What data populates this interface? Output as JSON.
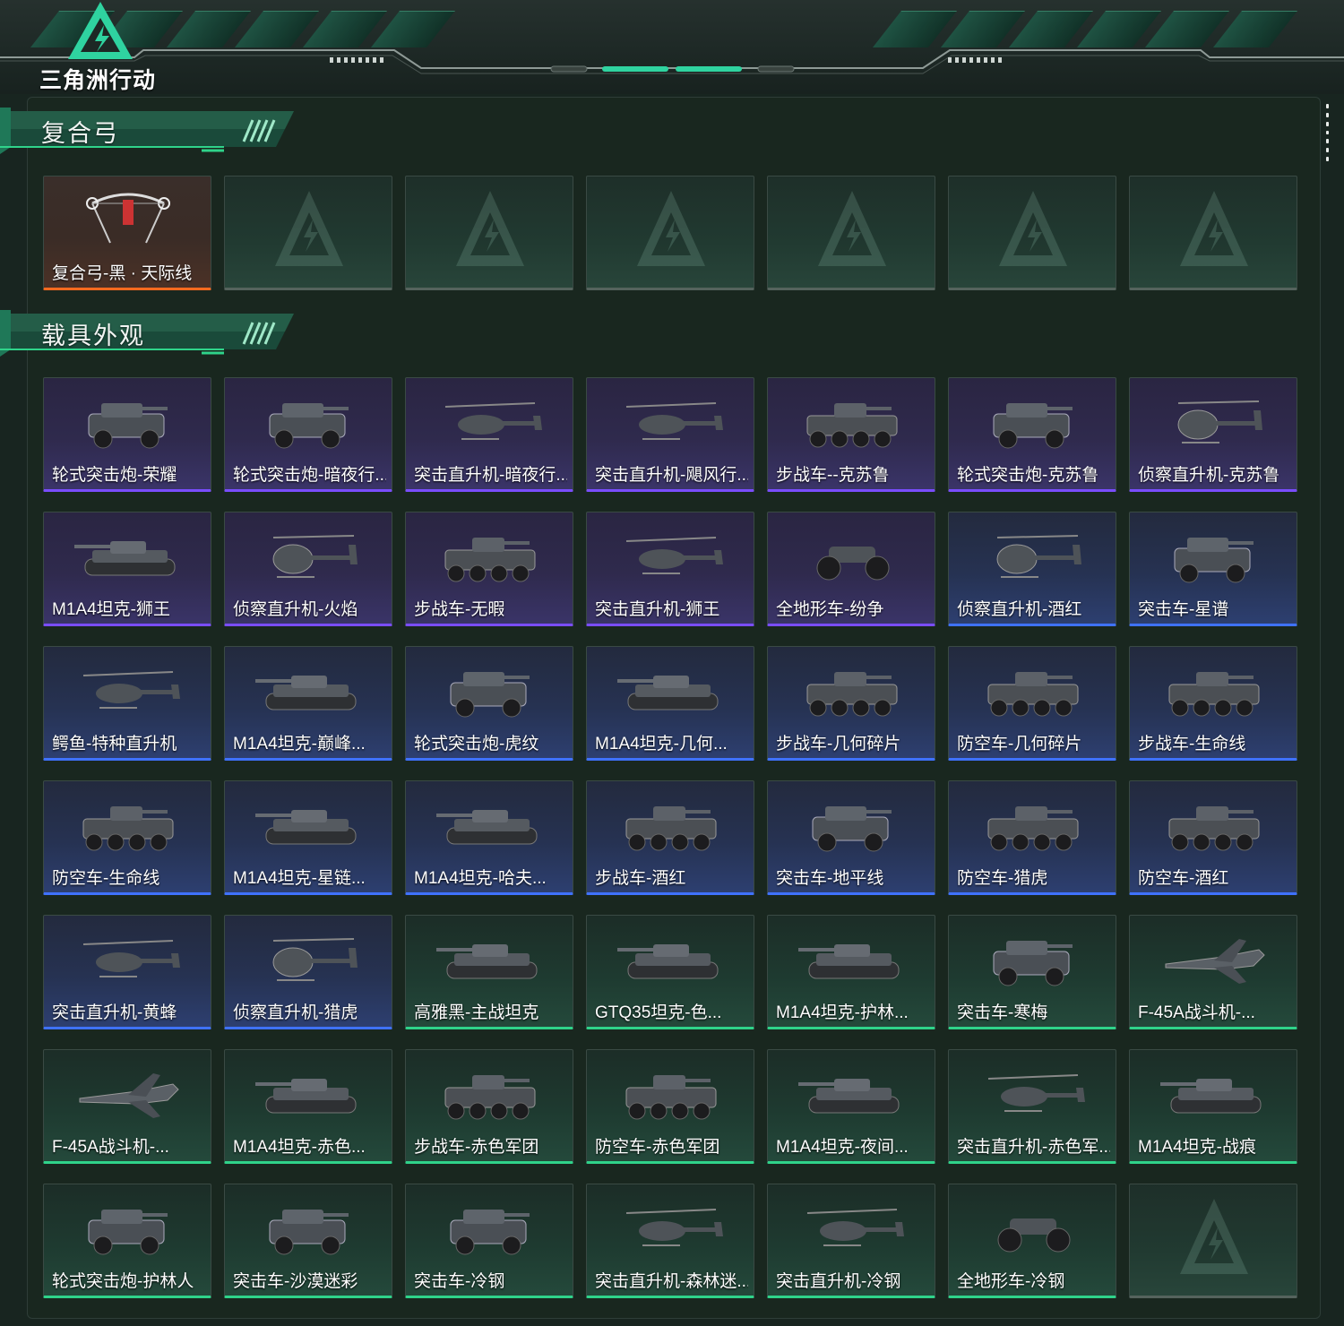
{
  "brand": {
    "logo_text": "三角洲行动"
  },
  "sections": [
    {
      "title": "复合弓",
      "items": [
        {
          "label": "复合弓-黑 · 天际线",
          "rarity": "orange",
          "icon": "bow-icon"
        },
        {
          "label": "",
          "rarity": "empty",
          "icon": ""
        },
        {
          "label": "",
          "rarity": "empty",
          "icon": ""
        },
        {
          "label": "",
          "rarity": "empty",
          "icon": ""
        },
        {
          "label": "",
          "rarity": "empty",
          "icon": ""
        },
        {
          "label": "",
          "rarity": "empty",
          "icon": ""
        },
        {
          "label": "",
          "rarity": "empty",
          "icon": ""
        }
      ]
    },
    {
      "title": "载具外观",
      "items": [
        {
          "label": "轮式突击炮-荣耀",
          "rarity": "purple",
          "icon": "armored-car-icon"
        },
        {
          "label": "轮式突击炮-暗夜行...",
          "rarity": "purple",
          "icon": "armored-car-icon"
        },
        {
          "label": "突击直升机-暗夜行...",
          "rarity": "purple",
          "icon": "helicopter-icon"
        },
        {
          "label": "突击直升机-飓风行...",
          "rarity": "purple",
          "icon": "helicopter-icon"
        },
        {
          "label": "步战车--克苏鲁",
          "rarity": "purple",
          "icon": "ifv-icon"
        },
        {
          "label": "轮式突击炮-克苏鲁",
          "rarity": "purple",
          "icon": "armored-car-icon"
        },
        {
          "label": "侦察直升机-克苏鲁",
          "rarity": "purple",
          "icon": "scout-heli-icon"
        },
        {
          "label": "M1A4坦克-狮王",
          "rarity": "purple",
          "icon": "tank-icon"
        },
        {
          "label": "侦察直升机-火焰",
          "rarity": "purple",
          "icon": "scout-heli-icon"
        },
        {
          "label": "步战车-无暇",
          "rarity": "purple",
          "icon": "ifv-icon"
        },
        {
          "label": "突击直升机-狮王",
          "rarity": "purple",
          "icon": "helicopter-icon"
        },
        {
          "label": "全地形车-纷争",
          "rarity": "purple",
          "icon": "atv-icon"
        },
        {
          "label": "侦察直升机-酒红",
          "rarity": "blue",
          "icon": "scout-heli-icon"
        },
        {
          "label": "突击车-星谱",
          "rarity": "blue",
          "icon": "armored-car-icon"
        },
        {
          "label": "鳄鱼-特种直升机",
          "rarity": "blue",
          "icon": "helicopter-icon"
        },
        {
          "label": "M1A4坦克-巅峰...",
          "rarity": "blue",
          "icon": "tank-icon"
        },
        {
          "label": "轮式突击炮-虎纹",
          "rarity": "blue",
          "icon": "armored-car-icon"
        },
        {
          "label": "M1A4坦克-几何...",
          "rarity": "blue",
          "icon": "tank-icon"
        },
        {
          "label": "步战车-几何碎片",
          "rarity": "blue",
          "icon": "ifv-icon"
        },
        {
          "label": "防空车-几何碎片",
          "rarity": "blue",
          "icon": "ifv-icon"
        },
        {
          "label": "步战车-生命线",
          "rarity": "blue",
          "icon": "ifv-icon"
        },
        {
          "label": "防空车-生命线",
          "rarity": "blue",
          "icon": "ifv-icon"
        },
        {
          "label": "M1A4坦克-星链...",
          "rarity": "blue",
          "icon": "tank-icon"
        },
        {
          "label": "M1A4坦克-哈夫...",
          "rarity": "blue",
          "icon": "tank-icon"
        },
        {
          "label": "步战车-酒红",
          "rarity": "blue",
          "icon": "ifv-icon"
        },
        {
          "label": "突击车-地平线",
          "rarity": "blue",
          "icon": "armored-car-icon"
        },
        {
          "label": "防空车-猎虎",
          "rarity": "blue",
          "icon": "ifv-icon"
        },
        {
          "label": "防空车-酒红",
          "rarity": "blue",
          "icon": "ifv-icon"
        },
        {
          "label": "突击直升机-黄蜂",
          "rarity": "blue",
          "icon": "helicopter-icon"
        },
        {
          "label": "侦察直升机-猎虎",
          "rarity": "blue",
          "icon": "scout-heli-icon"
        },
        {
          "label": "高雅黑-主战坦克",
          "rarity": "green",
          "icon": "tank-icon"
        },
        {
          "label": "GTQ35坦克-色...",
          "rarity": "green",
          "icon": "tank-icon"
        },
        {
          "label": "M1A4坦克-护林...",
          "rarity": "green",
          "icon": "tank-icon"
        },
        {
          "label": "突击车-寒梅",
          "rarity": "green",
          "icon": "armored-car-icon"
        },
        {
          "label": "F-45A战斗机-...",
          "rarity": "green",
          "icon": "jet-icon"
        },
        {
          "label": "F-45A战斗机-...",
          "rarity": "green",
          "icon": "jet-icon"
        },
        {
          "label": "M1A4坦克-赤色...",
          "rarity": "green",
          "icon": "tank-icon"
        },
        {
          "label": "步战车-赤色军团",
          "rarity": "green",
          "icon": "ifv-icon"
        },
        {
          "label": "防空车-赤色军团",
          "rarity": "green",
          "icon": "ifv-icon"
        },
        {
          "label": "M1A4坦克-夜间...",
          "rarity": "green",
          "icon": "tank-icon"
        },
        {
          "label": "突击直升机-赤色军...",
          "rarity": "green",
          "icon": "helicopter-icon"
        },
        {
          "label": "M1A4坦克-战痕",
          "rarity": "green",
          "icon": "tank-icon"
        },
        {
          "label": "轮式突击炮-护林人",
          "rarity": "green",
          "icon": "armored-car-icon"
        },
        {
          "label": "突击车-沙漠迷彩",
          "rarity": "green",
          "icon": "armored-car-icon"
        },
        {
          "label": "突击车-冷钢",
          "rarity": "green",
          "icon": "armored-car-icon"
        },
        {
          "label": "突击直升机-森林迷...",
          "rarity": "green",
          "icon": "helicopter-icon"
        },
        {
          "label": "突击直升机-冷钢",
          "rarity": "green",
          "icon": "helicopter-icon"
        },
        {
          "label": "全地形车-冷钢",
          "rarity": "green",
          "icon": "atv-icon"
        },
        {
          "label": "",
          "rarity": "empty",
          "icon": ""
        }
      ]
    }
  ],
  "colors": {
    "accent_green": "#2fd38a",
    "rarity_purple": "#7a4dff",
    "rarity_blue": "#3f72ff",
    "rarity_green": "#2fd38a",
    "rarity_orange": "#ff6a1f"
  }
}
